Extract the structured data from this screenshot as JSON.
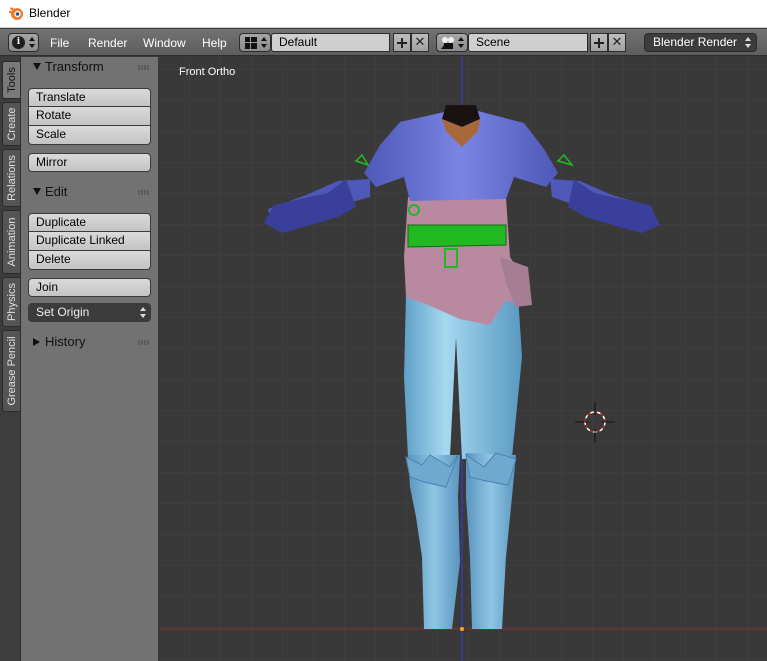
{
  "window": {
    "title": "Blender",
    "logo_icon": "blender-logo-icon"
  },
  "header": {
    "info_icon": "info-icon",
    "menus": [
      "File",
      "Render",
      "Window",
      "Help"
    ],
    "screen_layout": "Default",
    "scene": "Scene",
    "render_engine": "Blender Render"
  },
  "tabs": [
    "Tools",
    "Create",
    "Relations",
    "Animation",
    "Physics",
    "Grease Pencil"
  ],
  "active_tab": "Tools",
  "panels": {
    "transform": {
      "title": "Transform",
      "buttons": [
        "Translate",
        "Rotate",
        "Scale"
      ],
      "mirror": "Mirror"
    },
    "edit": {
      "title": "Edit",
      "buttons": [
        "Duplicate",
        "Duplicate Linked",
        "Delete"
      ],
      "join": "Join",
      "set_origin": "Set Origin"
    },
    "history": {
      "title": "History"
    }
  },
  "viewport": {
    "view_label": "Front Ortho",
    "colors": {
      "background": "#393939",
      "grid": "#444444",
      "y_axis": "#3a3aa8",
      "x_axis": "#8a2e2e",
      "shirt": "#6a74d8",
      "belt": "#22b822",
      "pants": "#82bedf",
      "undershirt": "#b8899f"
    }
  }
}
